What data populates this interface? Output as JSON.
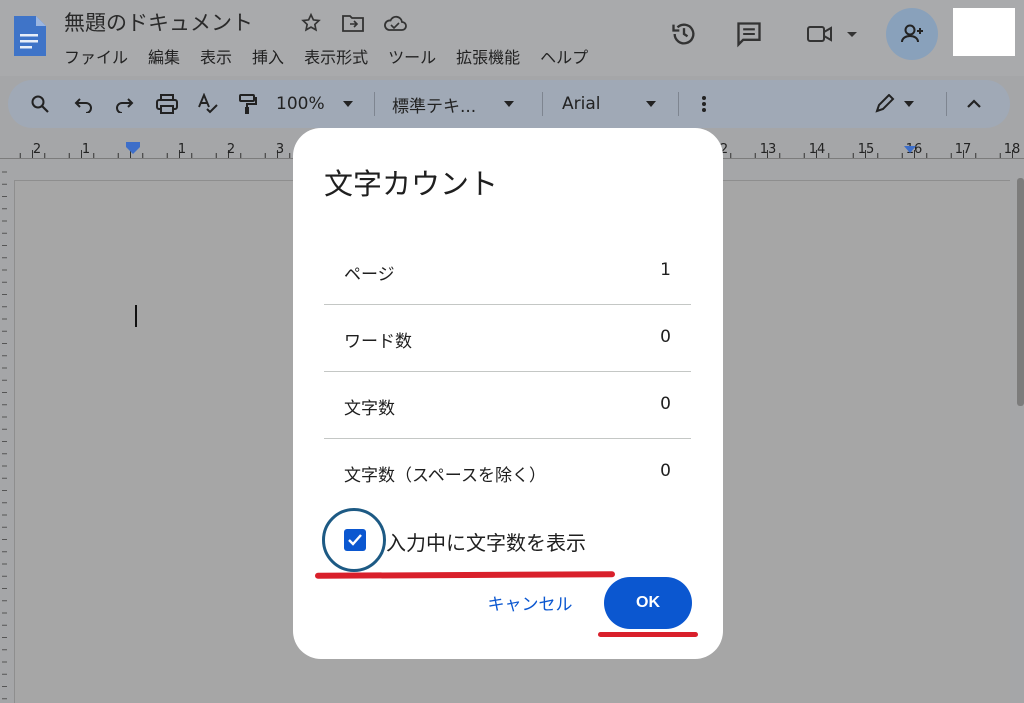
{
  "header": {
    "doc_title": "無題のドキュメント",
    "menu": [
      "ファイル",
      "編集",
      "表示",
      "挿入",
      "表示形式",
      "ツール",
      "拡張機能",
      "ヘルプ"
    ],
    "icons": [
      "star-icon",
      "move-to-folder-icon",
      "cloud-saved-icon"
    ],
    "right_icons": [
      "history-icon",
      "comment-icon",
      "video-call-icon",
      "share-icon"
    ]
  },
  "toolbar": {
    "zoom": "100%",
    "style": "標準テキ...",
    "font": "Arial",
    "icons": [
      "search-icon",
      "undo-icon",
      "redo-icon",
      "print-icon",
      "spellcheck-icon",
      "paint-format-icon",
      "more-icon",
      "edit-mode-icon",
      "collapse-icon"
    ]
  },
  "ruler": {
    "left_labels": [
      "2",
      "1",
      "1",
      "2",
      "3"
    ],
    "right_labels": [
      "2",
      "13",
      "14",
      "15",
      "16",
      "17",
      "18"
    ]
  },
  "dialog": {
    "title": "文字カウント",
    "rows": [
      {
        "label": "ページ",
        "value": "1"
      },
      {
        "label": "ワード数",
        "value": "0"
      },
      {
        "label": "文字数",
        "value": "0"
      },
      {
        "label": "文字数（スペースを除く）",
        "value": "0"
      }
    ],
    "checkbox_label": "入力中に文字数を表示",
    "checkbox_checked": true,
    "cancel_label": "キャンセル",
    "ok_label": "OK"
  },
  "colors": {
    "accent": "#0b57d0",
    "annotation": "#d9202b",
    "ring": "#1d5a84"
  }
}
